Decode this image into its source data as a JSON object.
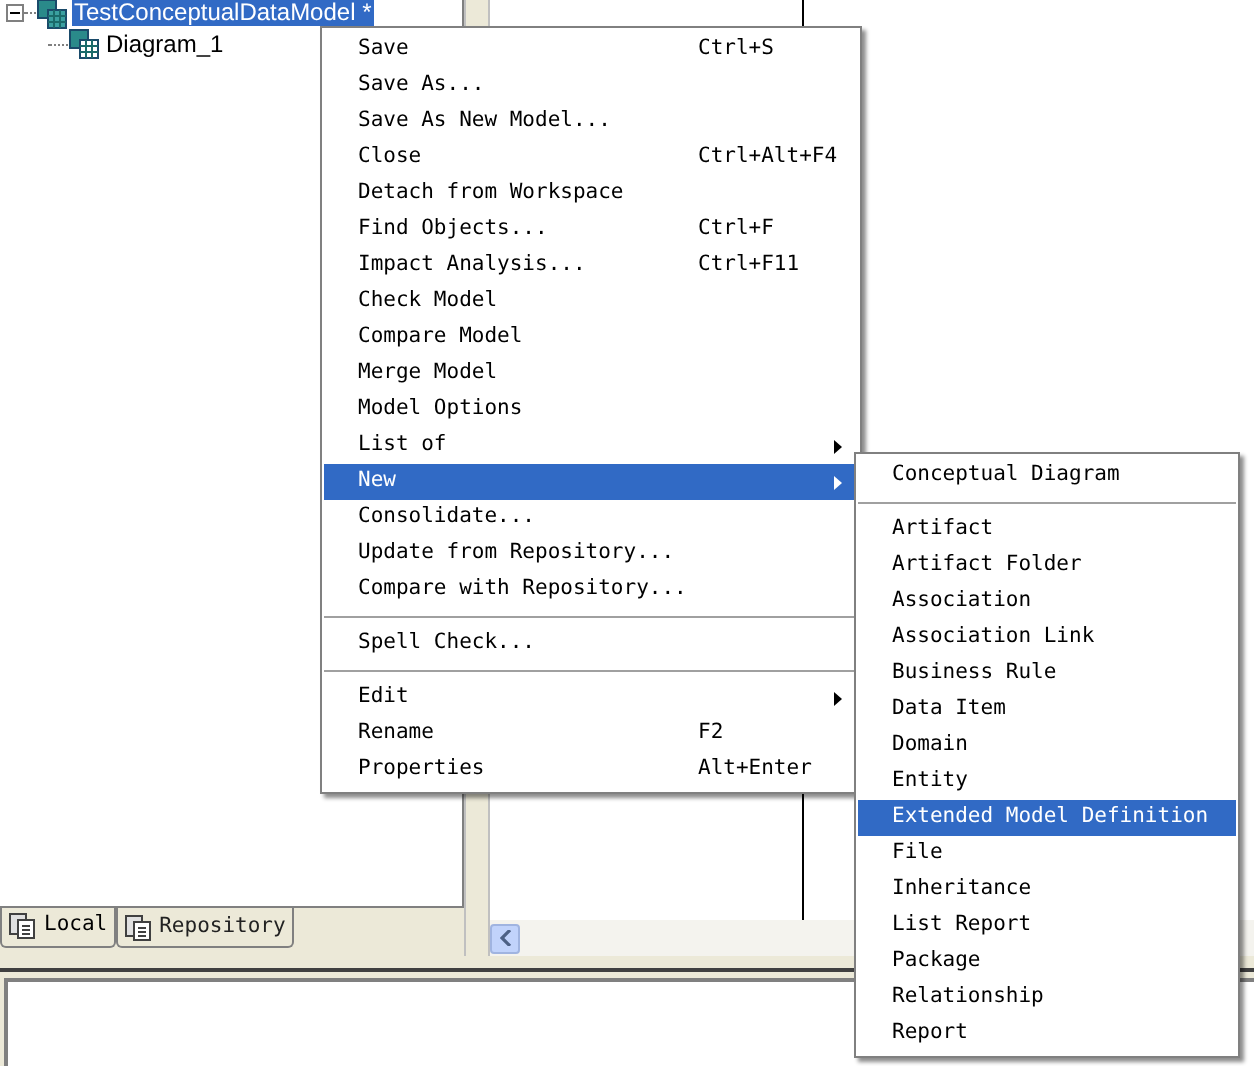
{
  "tree": {
    "root": {
      "label": "TestConceptualDataModel *",
      "selected": true,
      "expanded": true,
      "children": [
        {
          "label": "Diagram_1",
          "selected": false
        }
      ]
    }
  },
  "tabs": [
    {
      "label": "Local",
      "selected": true
    },
    {
      "label": "Repository",
      "selected": false
    }
  ],
  "context_menu": {
    "items": [
      {
        "kind": "item",
        "label": "Save",
        "shortcut": "Ctrl+S",
        "selected": false
      },
      {
        "kind": "item",
        "label": "Save As...",
        "selected": false
      },
      {
        "kind": "item",
        "label": "Save As New Model...",
        "selected": false
      },
      {
        "kind": "item",
        "label": "Close",
        "shortcut": "Ctrl+Alt+F4",
        "selected": false
      },
      {
        "kind": "item",
        "label": "Detach from Workspace",
        "selected": false
      },
      {
        "kind": "item",
        "label": "Find Objects...",
        "shortcut": "Ctrl+F",
        "selected": false
      },
      {
        "kind": "item",
        "label": "Impact Analysis...",
        "shortcut": "Ctrl+F11",
        "selected": false
      },
      {
        "kind": "item",
        "label": "Check Model",
        "selected": false
      },
      {
        "kind": "item",
        "label": "Compare Model",
        "selected": false
      },
      {
        "kind": "item",
        "label": "Merge Model",
        "selected": false
      },
      {
        "kind": "item",
        "label": "Model Options",
        "selected": false
      },
      {
        "kind": "submenu",
        "label": "List of",
        "selected": false
      },
      {
        "kind": "submenu",
        "label": "New",
        "selected": true
      },
      {
        "kind": "item",
        "label": "Consolidate...",
        "selected": false
      },
      {
        "kind": "item",
        "label": "Update from Repository...",
        "selected": false
      },
      {
        "kind": "item",
        "label": "Compare with Repository...",
        "selected": false
      },
      {
        "kind": "separator"
      },
      {
        "kind": "item",
        "label": "Spell Check...",
        "selected": false
      },
      {
        "kind": "separator"
      },
      {
        "kind": "submenu",
        "label": "Edit",
        "selected": false
      },
      {
        "kind": "item",
        "label": "Rename",
        "shortcut": "F2",
        "selected": false
      },
      {
        "kind": "item",
        "label": "Properties",
        "shortcut": "Alt+Enter",
        "selected": false
      }
    ]
  },
  "new_submenu": {
    "items": [
      {
        "kind": "item",
        "label": "Conceptual Diagram",
        "selected": false
      },
      {
        "kind": "separator"
      },
      {
        "kind": "item",
        "label": "Artifact",
        "selected": false
      },
      {
        "kind": "item",
        "label": "Artifact Folder",
        "selected": false
      },
      {
        "kind": "item",
        "label": "Association",
        "selected": false
      },
      {
        "kind": "item",
        "label": "Association Link",
        "selected": false
      },
      {
        "kind": "item",
        "label": "Business Rule",
        "selected": false
      },
      {
        "kind": "item",
        "label": "Data Item",
        "selected": false
      },
      {
        "kind": "item",
        "label": "Domain",
        "selected": false
      },
      {
        "kind": "item",
        "label": "Entity",
        "selected": false
      },
      {
        "kind": "item",
        "label": "Extended Model Definition",
        "selected": true
      },
      {
        "kind": "item",
        "label": "File",
        "selected": false
      },
      {
        "kind": "item",
        "label": "Inheritance",
        "selected": false
      },
      {
        "kind": "item",
        "label": "List Report",
        "selected": false
      },
      {
        "kind": "item",
        "label": "Package",
        "selected": false
      },
      {
        "kind": "item",
        "label": "Relationship",
        "selected": false
      },
      {
        "kind": "item",
        "label": "Report",
        "selected": false
      }
    ]
  }
}
